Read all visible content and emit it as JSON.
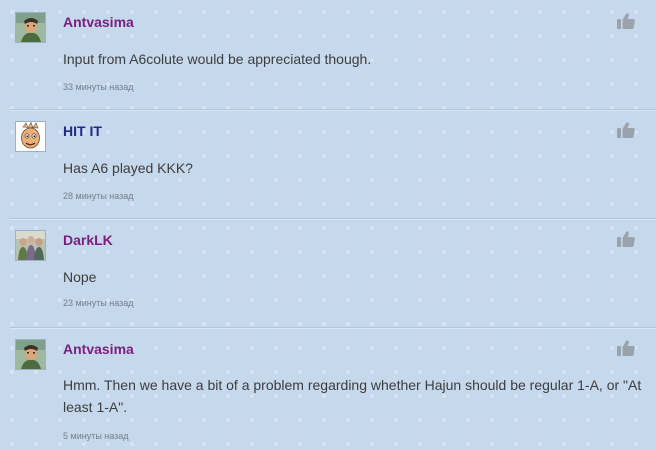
{
  "comments": [
    {
      "author": "Antvasima",
      "avatar_icon": "character-avatar-icon",
      "text": "Input from A6colute would be appreciated though.",
      "time": "33 минуты назад"
    },
    {
      "author": "HIT IT",
      "avatar_icon": "cartoon-face-avatar-icon",
      "text": "Has A6 played KKK?",
      "time": "28 минуты назад"
    },
    {
      "author": "DarkLK",
      "avatar_icon": "group-avatar-icon",
      "text": "Nope",
      "time": "23 минуты назад"
    },
    {
      "author": "Antvasima",
      "avatar_icon": "character-avatar-icon",
      "text": "Hmm. Then we have a bit of a problem regarding whether Hajun should be regular 1-A, or \"At least 1-A\".",
      "time": "5 минуты назад"
    }
  ],
  "colors": {
    "background": "#c5d8ec",
    "author_purple": "#7b1e7e",
    "author_navy": "#1f2a86",
    "body_text": "#3d3d3d",
    "timestamp": "#75808c",
    "like_icon": "#9aa3ab"
  }
}
